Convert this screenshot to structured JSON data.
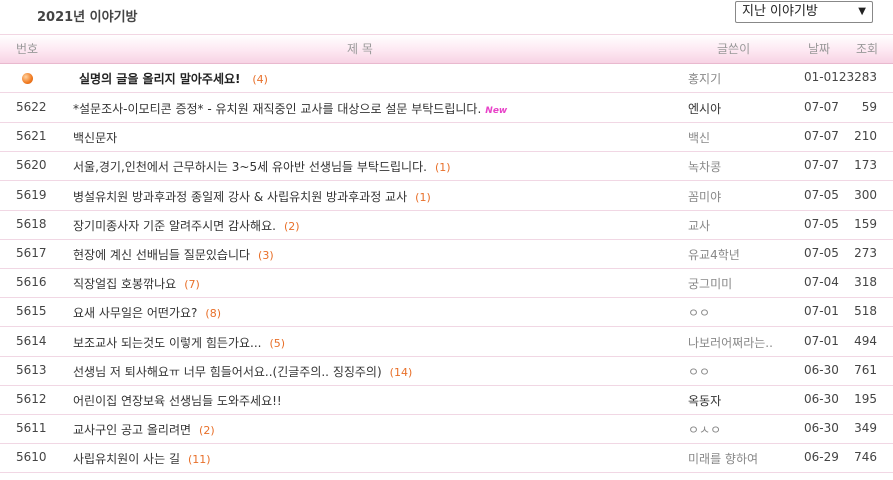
{
  "page_title": "2021년 이야기방",
  "archive_select": {
    "value": "지난 이야기방"
  },
  "columns": {
    "num": "번호",
    "subject": "제 목",
    "writer": "글쓴이",
    "date": "날짜",
    "views": "조회"
  },
  "notice": {
    "subject": "실명의 글을 올리지 말아주세요!",
    "comments": "(4)",
    "writer": "홍지기",
    "date": "01-01",
    "views": "23283"
  },
  "rows": [
    {
      "num": "5622",
      "subject": "*설문조사-이모티콘 증정* - 유치원 재직중인 교사를 대상으로 설문 부탁드립니다.",
      "comments": "",
      "new": "New",
      "writer": "엔시아",
      "date": "07-07",
      "views": "59"
    },
    {
      "num": "5621",
      "subject": "백신문자",
      "comments": "",
      "writer": "백신",
      "date": "07-07",
      "views": "210"
    },
    {
      "num": "5620",
      "subject": "서울,경기,인천에서 근무하시는 3~5세 유아반 선생님들 부탁드립니다.",
      "comments": "(1)",
      "writer": "녹차콩",
      "date": "07-07",
      "views": "173"
    },
    {
      "num": "5619",
      "subject": "병설유치원 방과후과정 종일제 강사 & 사립유치원 방과후과정 교사",
      "comments": "(1)",
      "writer": "꼼미야",
      "date": "07-05",
      "views": "300"
    },
    {
      "num": "5618",
      "subject": "장기미종사자 기준 알려주시면 감사해요.",
      "comments": "(2)",
      "writer": "교사",
      "date": "07-05",
      "views": "159"
    },
    {
      "num": "5617",
      "subject": "현장에 계신 선배님들 질문있습니다",
      "comments": "(3)",
      "writer": "유교4학년",
      "date": "07-05",
      "views": "273"
    },
    {
      "num": "5616",
      "subject": "직장얼집 호봉깎나요",
      "comments": "(7)",
      "writer": "궁그미미",
      "date": "07-04",
      "views": "318"
    },
    {
      "num": "5615",
      "subject": "요새 사무일은 어떤가요?",
      "comments": "(8)",
      "writer": "ㅇㅇ",
      "date": "07-01",
      "views": "518"
    },
    {
      "num": "5614",
      "subject": "보조교사 되는것도 이렇게 힘든가요...",
      "comments": "(5)",
      "writer": "나보러어쩌라는..",
      "date": "07-01",
      "views": "494"
    },
    {
      "num": "5613",
      "subject": "선생님 저 퇴사해요ㅠ 너무 힘들어서요..(긴글주의.. 징징주의)",
      "comments": "(14)",
      "writer": "ㅇㅇ",
      "date": "06-30",
      "views": "761"
    },
    {
      "num": "5612",
      "subject": "어린이집 연장보육 선생님들 도와주세요!!",
      "comments": "",
      "writer": "옥동자",
      "date": "06-30",
      "views": "195"
    },
    {
      "num": "5611",
      "subject": "교사구인 공고 올리려면",
      "comments": "(2)",
      "writer": "ㅇㅅㅇ",
      "date": "06-30",
      "views": "349"
    },
    {
      "num": "5610",
      "subject": "사립유치원이 사는 길",
      "comments": "(11)",
      "writer": "미래를 향하여",
      "date": "06-29",
      "views": "746"
    }
  ]
}
